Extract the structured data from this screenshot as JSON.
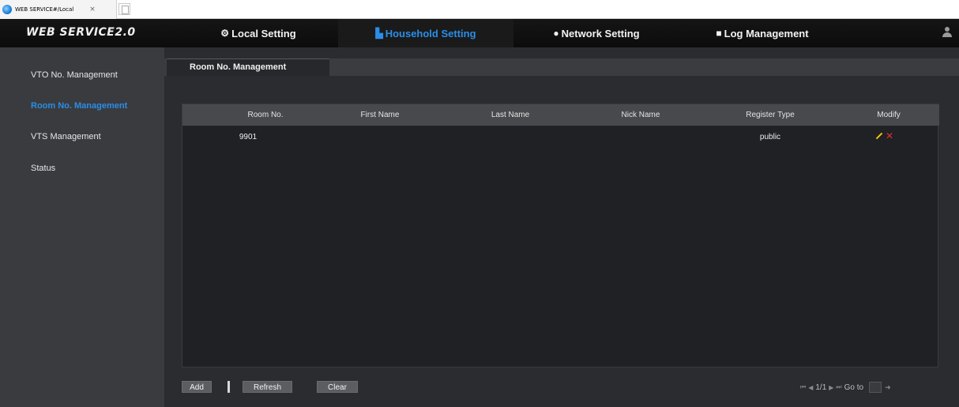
{
  "browser": {
    "tab_title": "WEB SERVICE#/Local",
    "tab_close": "×"
  },
  "header": {
    "brand": "WEB SERVICE2.0",
    "nav": [
      {
        "label": "Local Setting",
        "icon": "gear-icon",
        "glyph": "⚙"
      },
      {
        "label": "Household Setting",
        "icon": "household-icon",
        "glyph": "▙"
      },
      {
        "label": "Network Setting",
        "icon": "globe-icon",
        "glyph": "●"
      },
      {
        "label": "Log Management",
        "icon": "log-icon",
        "glyph": "■"
      }
    ],
    "active_index": 1,
    "accent_color": "#2a8ee8"
  },
  "sidebar": {
    "items": [
      {
        "label": "VTO No. Management"
      },
      {
        "label": "Room No. Management"
      },
      {
        "label": "VTS Management"
      },
      {
        "label": "Status"
      }
    ],
    "active_index": 1
  },
  "page": {
    "tab_label": "Room No. Management"
  },
  "table": {
    "columns": [
      "Room No.",
      "First Name",
      "Last Name",
      "Nick Name",
      "Register Type",
      "Modify"
    ],
    "rows": [
      {
        "room_no": "9901",
        "first_name": "",
        "last_name": "",
        "nick_name": "",
        "register_type": "public"
      }
    ]
  },
  "actions": {
    "add": "Add",
    "refresh": "Refresh",
    "clear": "Clear"
  },
  "pager": {
    "first": "⏮",
    "prev": "◀",
    "page_text": "1/1",
    "next": "▶",
    "last": "⏭",
    "goto_label": "Go to",
    "goto_value": "",
    "go": "➜"
  }
}
